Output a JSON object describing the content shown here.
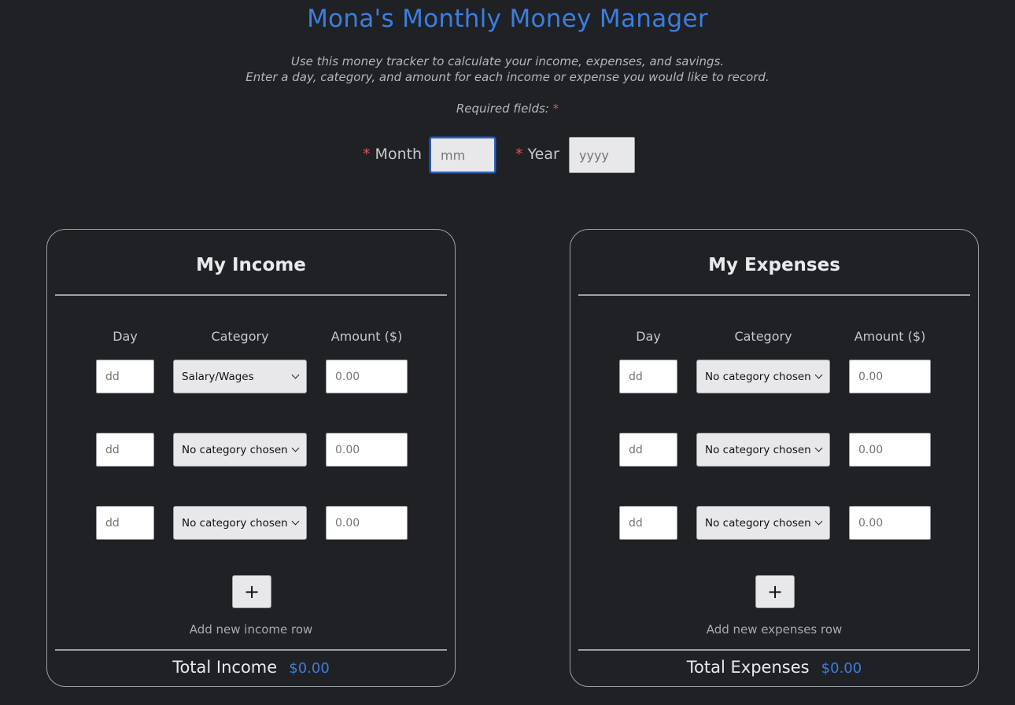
{
  "header": {
    "title": "Mona's Monthly Money Manager",
    "intro_line1": "Use this money tracker to calculate your income, expenses, and savings.",
    "intro_line2": "Enter a day, category, and amount for each income or expense you would like to record.",
    "required_label": "Required fields:",
    "required_marker": "*"
  },
  "period": {
    "month_label": "Month",
    "month_placeholder": "mm",
    "year_label": "Year",
    "year_placeholder": "yyyy"
  },
  "income": {
    "title": "My Income",
    "columns": {
      "day": "Day",
      "category": "Category",
      "amount": "Amount ($)"
    },
    "rows": [
      {
        "day_placeholder": "dd",
        "category": "Salary/Wages",
        "amount_placeholder": "0.00"
      },
      {
        "day_placeholder": "dd",
        "category": "No category chosen",
        "amount_placeholder": "0.00"
      },
      {
        "day_placeholder": "dd",
        "category": "No category chosen",
        "amount_placeholder": "0.00"
      }
    ],
    "add_button": "+",
    "add_label": "Add new income row",
    "total_label": "Total Income",
    "total_value": "$0.00"
  },
  "expenses": {
    "title": "My Expenses",
    "columns": {
      "day": "Day",
      "category": "Category",
      "amount": "Amount ($)"
    },
    "rows": [
      {
        "day_placeholder": "dd",
        "category": "No category chosen",
        "amount_placeholder": "0.00"
      },
      {
        "day_placeholder": "dd",
        "category": "No category chosen",
        "amount_placeholder": "0.00"
      },
      {
        "day_placeholder": "dd",
        "category": "No category chosen",
        "amount_placeholder": "0.00"
      }
    ],
    "add_button": "+",
    "add_label": "Add new expenses row",
    "total_label": "Total Expenses",
    "total_value": "$0.00"
  },
  "colors": {
    "background": "#202124",
    "accent": "#3b7ee0",
    "required_star": "#d65a5a",
    "border": "#9aa0a6"
  }
}
